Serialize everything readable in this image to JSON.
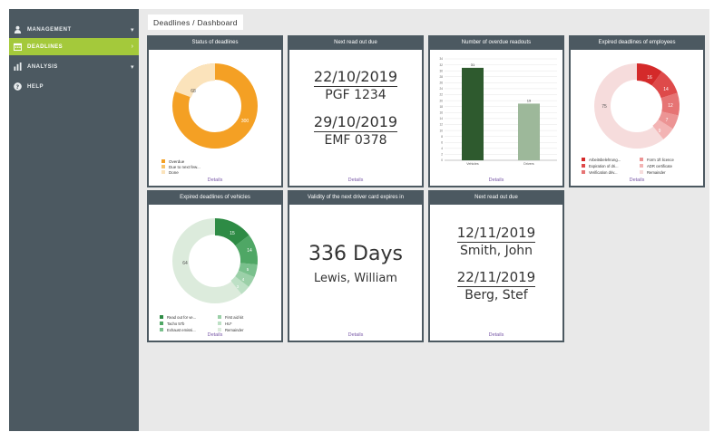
{
  "sidebar": {
    "items": [
      {
        "label": "MANAGEMENT",
        "icon": "user-icon",
        "arrow": "▾"
      },
      {
        "label": "DEADLINES",
        "icon": "calendar-icon",
        "arrow": "›"
      },
      {
        "label": "ANALYSIS",
        "icon": "bar-chart-icon",
        "arrow": "▾"
      },
      {
        "label": "HELP",
        "icon": "help-icon",
        "arrow": ""
      }
    ],
    "active_color": "#a4c93b",
    "bg_color": "#4c5961"
  },
  "breadcrumb": "Deadlines / Dashboard",
  "cards": {
    "status": {
      "title": "Status of deadlines",
      "values": [
        {
          "label": "Overdue",
          "value": 300,
          "color": "#f4a024"
        },
        {
          "label": "Due to next few...",
          "value": 0,
          "color": "#f7c36b"
        },
        {
          "label": "Done",
          "value": 68,
          "color": "#fbe3bb"
        }
      ],
      "label_overdue": "300",
      "label_done": "68",
      "legend": [
        "Overdue",
        "Due to next few...",
        "Done"
      ],
      "link": "Details"
    },
    "next_readout": {
      "title": "Next read out due",
      "date1": "22/10/2019",
      "plate1": "PGF 1234",
      "date2": "29/10/2019",
      "plate2": "EMF 0378",
      "link": "Details"
    },
    "overdue": {
      "title": "Number of overdue readouts",
      "link": "Details"
    },
    "employees": {
      "title": "Expired deadlines of employees",
      "label_big": "75",
      "seg_labels": [
        "16",
        "14",
        "12",
        "7",
        "9"
      ],
      "legend": [
        "Arbeitsbelehrung...",
        "Expiration of dri...",
        "Verification driv...",
        "Form 1ft licence",
        "ADR certificate",
        "Remainder"
      ],
      "link": "Details"
    },
    "vehicles": {
      "title": "Expired deadlines of vehicles",
      "label_big": "64",
      "seg_labels": [
        "15",
        "14",
        "5",
        "4",
        "3"
      ],
      "legend": [
        "Read out for ve...",
        "Tacho 57b",
        "Exhaust emissi...",
        "First aid kit",
        "HU*",
        "Remainder"
      ],
      "link": "Details"
    },
    "driver_card": {
      "title": "Validity of the next driver card expires in",
      "days": "336 Days",
      "name": "Lewis, William",
      "link": "Details"
    },
    "next_readout2": {
      "title": "Next read out due",
      "date1": "12/11/2019",
      "name1": "Smith, John",
      "date2": "22/11/2019",
      "name2": "Berg, Stef",
      "link": "Details"
    }
  },
  "chart_data": {
    "type": "bar",
    "categories": [
      "Vehicles",
      "Drivers"
    ],
    "values": [
      31,
      19
    ],
    "bar_labels": [
      "31",
      "19"
    ],
    "colors": [
      "#2e5a2e",
      "#9db89a"
    ],
    "ylim": [
      0,
      34
    ],
    "yticks": [
      "0",
      "2",
      "4",
      "6",
      "8",
      "10",
      "12",
      "14",
      "16",
      "18",
      "20",
      "22",
      "24",
      "26",
      "28",
      "30",
      "32",
      "34"
    ],
    "xlabel": "",
    "ylabel": "",
    "grid": true
  }
}
